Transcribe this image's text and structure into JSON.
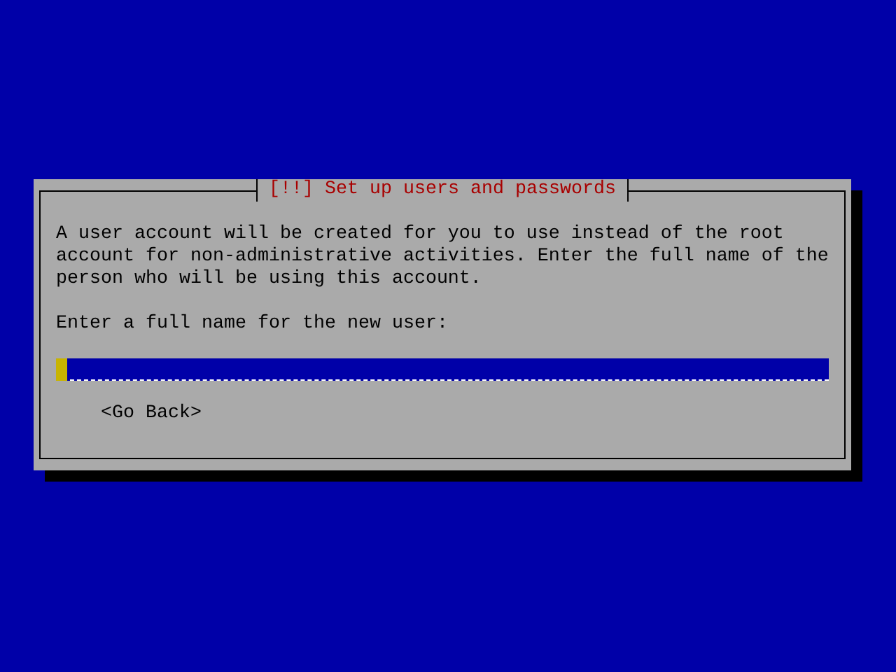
{
  "dialog": {
    "title": "[!!] Set up users and passwords",
    "message": "A user account will be created for you to use instead of the root account for non-administrative activities. Enter the full name of the person who will be using this account.",
    "field_label": "Enter a full name for the new user:",
    "buttons": [
      "<Go Back>"
    ]
  }
}
